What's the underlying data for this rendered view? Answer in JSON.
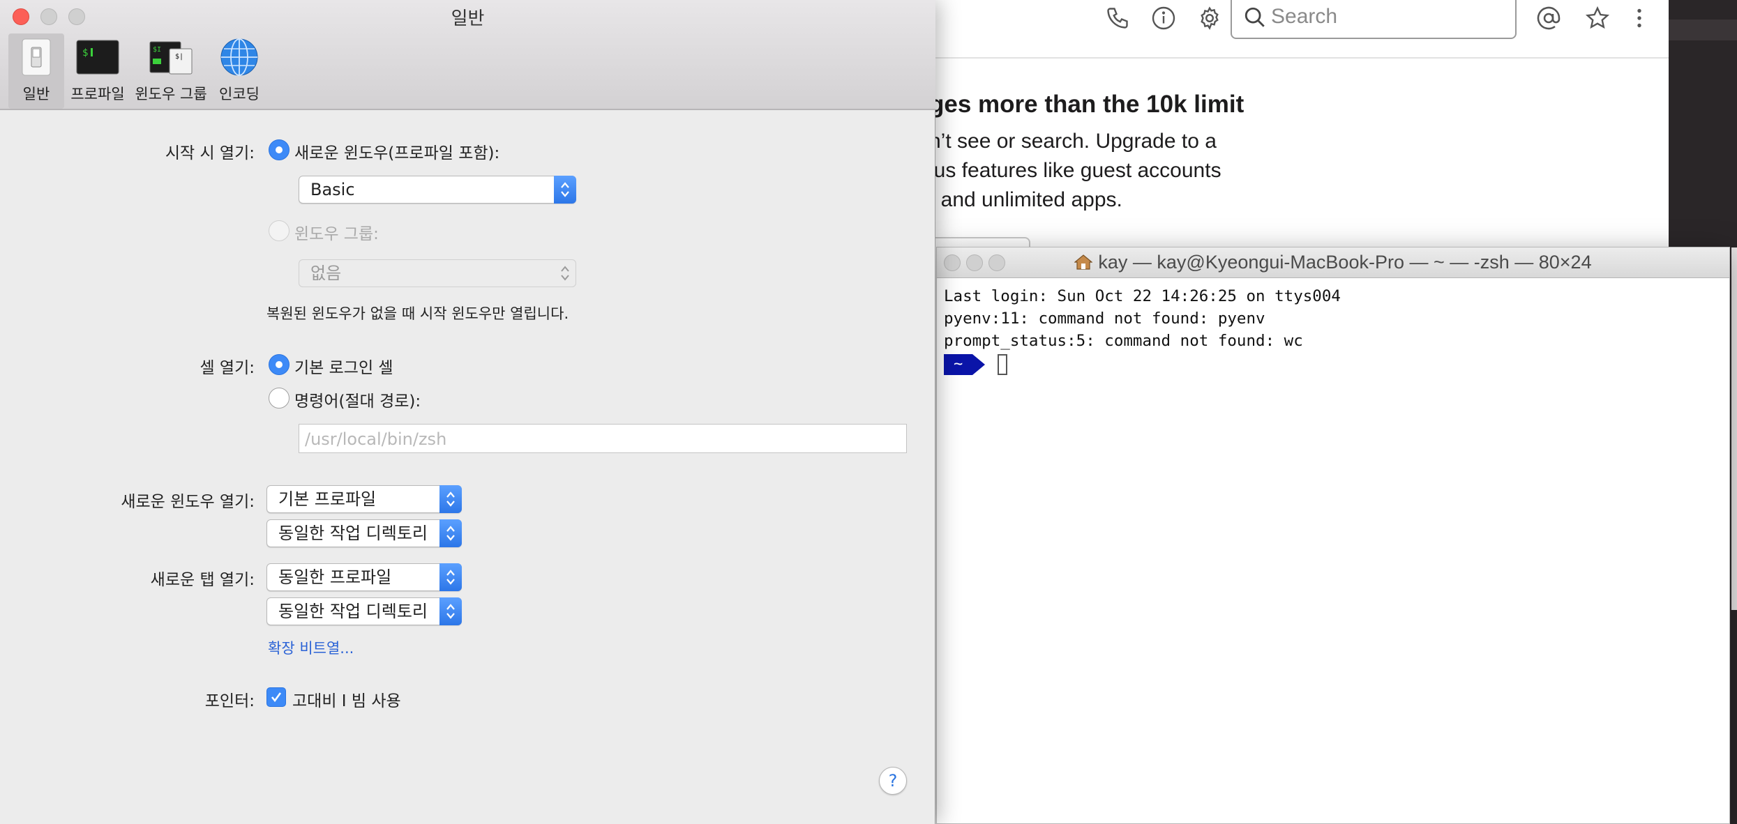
{
  "slack": {
    "search_placeholder": "Search",
    "banner_title": "ges more than the 10k limit",
    "banner_lines": [
      "n’t see or search. Upgrade to a",
      "lus features like guest accounts",
      ", and unlimited apps."
    ],
    "icons": [
      "phone-icon",
      "info-icon",
      "gear-icon",
      "search-icon",
      "mention-icon",
      "star-icon",
      "more-vertical-icon"
    ]
  },
  "terminal": {
    "title": "kay — kay@Kyeongui-MacBook-Pro — ~ — -zsh — 80×24",
    "lines": [
      "Last login: Sun Oct 22 14:26:25 on ttys004",
      "pyenv:11: command not found: pyenv",
      "prompt_status:5: command not found: wc"
    ],
    "prompt_dir": "~"
  },
  "prefs": {
    "title": "일반",
    "tabs": [
      "일반",
      "프로파일",
      "윈도우 그룹",
      "인코딩"
    ],
    "startup_label": "시작 시 열기:",
    "startup_new_window": "새로운 윈도우(프로파일 포함):",
    "startup_profile_value": "Basic",
    "startup_window_group": "윈도우 그룹:",
    "startup_group_value": "없음",
    "startup_note": "복원된 윈도우가 없을 때 시작 윈도우만 열립니다.",
    "shell_label": "셀 열기:",
    "shell_default": "기본 로그인 셀",
    "shell_command": "명령어(절대 경로):",
    "shell_command_placeholder": "/usr/local/bin/zsh",
    "new_window_label": "새로운 윈도우 열기:",
    "new_window_profile": "기본 프로파일",
    "new_window_dir": "동일한 작업 디렉토리",
    "new_tab_label": "새로운 탭 열기:",
    "new_tab_profile": "동일한 프로파일",
    "new_tab_dir": "동일한 작업 디렉토리",
    "escape_link": "확장 비트열...",
    "pointer_label": "포인터:",
    "pointer_checkbox": "고대비 I 빔 사용",
    "pointer_checked": true,
    "help": "?"
  }
}
